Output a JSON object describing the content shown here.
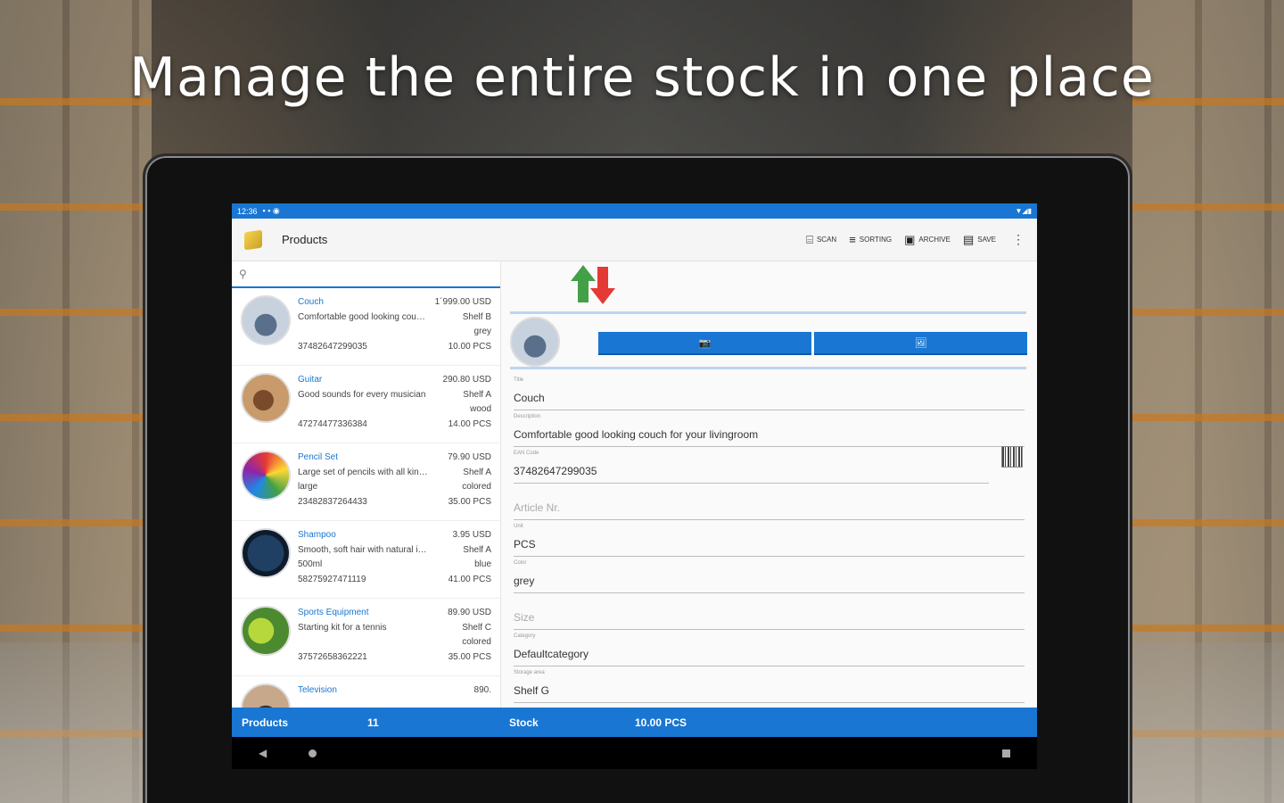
{
  "headline": "Manage the entire stock in one place",
  "statusbar": {
    "time": "12:36",
    "icons": "▼◢▮"
  },
  "toolbar": {
    "title": "Products",
    "scan": "Scan",
    "sorting": "Sorting",
    "archive": "Archive",
    "save": "Save"
  },
  "search": {
    "icon": "search-icon"
  },
  "products": [
    {
      "name": "Couch",
      "price": "1´999.00 USD",
      "desc": "Comfortable good looking cou…",
      "shelf": "Shelf B",
      "color": "grey",
      "barcode": "37482647299035",
      "qty": "10.00 PCS"
    },
    {
      "name": "Guitar",
      "price": "290.80 USD",
      "desc": "Good sounds for every musician",
      "shelf": "Shelf A",
      "color": "wood",
      "barcode": "47274477336384",
      "qty": "14.00 PCS"
    },
    {
      "name": "Pencil Set",
      "price": "79.90 USD",
      "desc": "Large set of pencils with all kin…",
      "shelf": "Shelf A",
      "color": "colored",
      "extra": "large",
      "barcode": "23482837264433",
      "qty": "35.00 PCS"
    },
    {
      "name": "Shampoo",
      "price": "3.95 USD",
      "desc": "Smooth, soft hair with natural i…",
      "shelf": "Shelf A",
      "color": "blue",
      "extra": "500ml",
      "barcode": "58275927471119",
      "qty": "41.00 PCS"
    },
    {
      "name": "Sports Equipment",
      "price": "89.90 USD",
      "desc": "Starting kit for a tennis",
      "shelf": "Shelf C",
      "color": "colored",
      "barcode": "37572658362221",
      "qty": "35.00 PCS"
    },
    {
      "name": "Television",
      "price": "890.",
      "desc": "",
      "shelf": "",
      "color": "",
      "barcode": "",
      "qty": ""
    }
  ],
  "fab": "+",
  "detail": {
    "camera_button": "📷",
    "image_button": "🖼",
    "fields": [
      {
        "label": "Title",
        "value": "Couch"
      },
      {
        "label": "Description",
        "value": "Comfortable good looking couch for your livingroom"
      },
      {
        "label": "EAN Code",
        "value": "37482647299035"
      },
      {
        "label": "",
        "value": "Article Nr."
      },
      {
        "label": "Unit",
        "value": "PCS"
      },
      {
        "label": "Color",
        "value": "grey"
      },
      {
        "label": "",
        "value": "Size"
      },
      {
        "label": "Category",
        "value": "Defaultcategory"
      },
      {
        "label": "Storage area",
        "value": "Shelf G"
      }
    ]
  },
  "bottombar": {
    "products_label": "Products",
    "products_count": "11",
    "stock_label": "Stock",
    "stock_value": "10.00 PCS"
  },
  "colors": {
    "primary": "#1976d2",
    "fab": "#1e88e5"
  }
}
